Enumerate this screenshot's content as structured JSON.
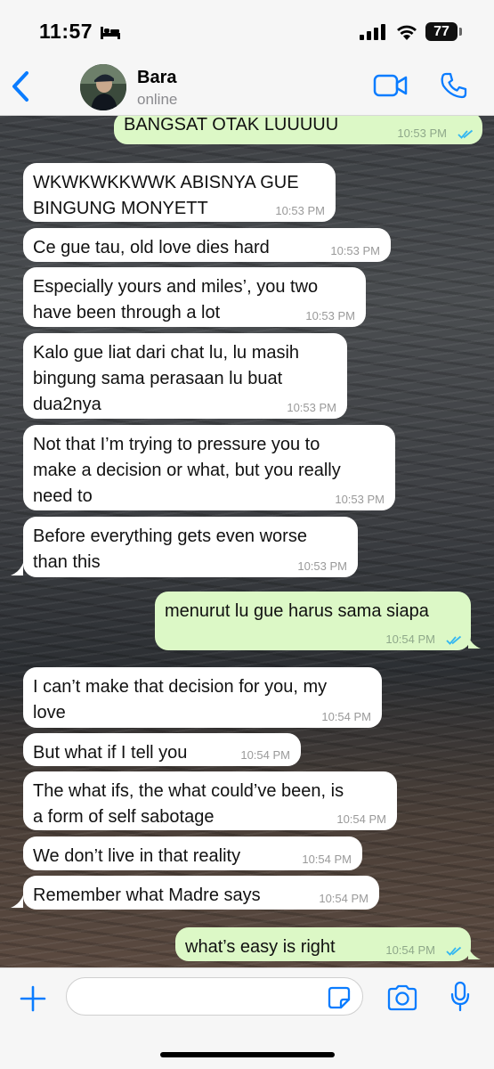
{
  "status_bar": {
    "time": "11:57",
    "battery": "77"
  },
  "header": {
    "contact_name": "Bara",
    "contact_status": "online"
  },
  "messages": [
    {
      "dir": "out",
      "text": "BANGSAT OTAK LUUUUU",
      "time": "10:53 PM",
      "read": true
    },
    {
      "dir": "in",
      "text": "WKWKWKKWWK ABISNYA GUE\nBINGUNG MONYETT",
      "time": "10:53 PM"
    },
    {
      "dir": "in",
      "text": "Ce gue tau, old love dies hard",
      "time": "10:53 PM"
    },
    {
      "dir": "in",
      "text": "Especially yours and miles’, you two\nhave been through a lot",
      "time": "10:53 PM"
    },
    {
      "dir": "in",
      "text": "Kalo gue liat dari chat lu, lu masih\nbingung sama perasaan lu buat\ndua2nya",
      "time": "10:53 PM"
    },
    {
      "dir": "in",
      "text": "Not that I’m trying to pressure you to\nmake a decision or what, but you really\nneed to",
      "time": "10:53 PM"
    },
    {
      "dir": "in",
      "text": "Before everything gets even worse\nthan this",
      "time": "10:53 PM",
      "tail": true
    },
    {
      "dir": "out",
      "text": "menurut lu gue harus sama siapa",
      "time": "10:54 PM",
      "read": true
    },
    {
      "dir": "in",
      "text": "I can’t make that decision for you, my\nlove",
      "time": "10:54 PM"
    },
    {
      "dir": "in",
      "text": "But what if I tell you",
      "time": "10:54 PM"
    },
    {
      "dir": "in",
      "text": "The what ifs, the what could’ve been, is\na form of self sabotage",
      "time": "10:54 PM"
    },
    {
      "dir": "in",
      "text": "We don’t live in that reality",
      "time": "10:54 PM"
    },
    {
      "dir": "in",
      "text": "Remember what Madre says",
      "time": "10:54 PM",
      "tail": true
    },
    {
      "dir": "out",
      "text": "what’s easy is right",
      "time": "10:54 PM",
      "read": true
    }
  ],
  "composer": {
    "value": "",
    "placeholder": ""
  },
  "colors": {
    "accent": "#0a7cff",
    "outgoing_bubble": "#dcf8c6",
    "incoming_bubble": "#ffffff",
    "read_ticks": "#34b7f1"
  }
}
